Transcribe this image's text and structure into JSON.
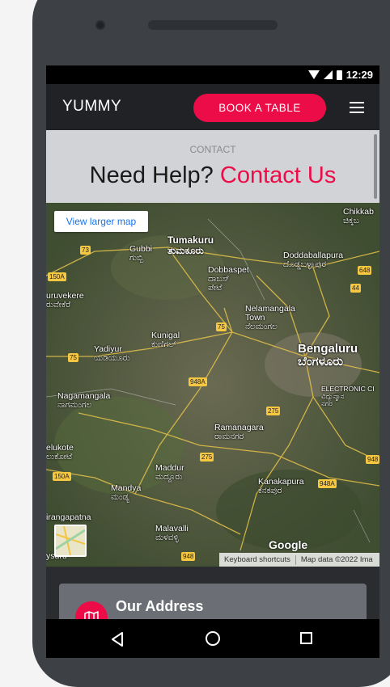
{
  "status": {
    "time": "12:29"
  },
  "header": {
    "logo": "YUMMY",
    "book_label": "BOOK A TABLE"
  },
  "section": {
    "label": "CONTACT",
    "title_plain": "Need Help?",
    "title_accent": "Contact Us"
  },
  "map": {
    "view_larger": "View larger map",
    "places": [
      {
        "name": "Tumakuru\nತುಮಕೂರು",
        "kind": "mid"
      },
      {
        "name": "Gubbi\nಗುಬ್ಬಿ",
        "kind": "small"
      },
      {
        "name": "Doddaballapura\nದೊಡ್ಡಬಳ್ಳಾಪುರ",
        "kind": "small"
      },
      {
        "name": "Chikkab\nಚಿಕ್ಕಬ",
        "kind": "small"
      },
      {
        "name": "Dobbaspet\nದಾಬಸ್\nಪೇಟೆ",
        "kind": "small"
      },
      {
        "name": "uruvekere\nರುವೇಕೆರೆ",
        "kind": "small"
      },
      {
        "name": "Nelamangala\nTown\nನೆಲಮಂಗಲ",
        "kind": "small"
      },
      {
        "name": "Kunigal\nಕುಣಿಗಲ್",
        "kind": "small"
      },
      {
        "name": "Yadiyur\nಯಡಿಯೂರು",
        "kind": "small"
      },
      {
        "name": "Bengaluru\nಬೆಂಗಳೂರು",
        "kind": "big"
      },
      {
        "name": "ELECTRONIC CI\nವಿದ್ಯುನ್ಮಾನ\nನಗರ",
        "kind": "small"
      },
      {
        "name": "Nagamangala\nನಾಗಮಂಗಲ",
        "kind": "small"
      },
      {
        "name": "Ramanagara\nರಾಮನಗರ",
        "kind": "small"
      },
      {
        "name": "elukote\nಲುಕೋಟೆ",
        "kind": "small"
      },
      {
        "name": "Maddur\nಮದ್ದೂರು",
        "kind": "small"
      },
      {
        "name": "Mandya\nಮಂಡ್ಯ",
        "kind": "small"
      },
      {
        "name": "Kanakapura\nಕನಕಪುರ",
        "kind": "small"
      },
      {
        "name": "irangapatna",
        "kind": "small"
      },
      {
        "name": "Malavalli\nಮಳವಳ್ಳಿ",
        "kind": "small"
      },
      {
        "name": "ysuru",
        "kind": "small"
      }
    ],
    "roads": [
      "73",
      "150A",
      "648",
      "44",
      "75",
      "75",
      "948A",
      "275",
      "275",
      "150A",
      "948A",
      "948",
      "948"
    ],
    "google": "Google",
    "footer_shortcuts": "Keyboard shortcuts",
    "footer_data": "Map data ©2022 Ima"
  },
  "address": {
    "title": "Our Address"
  },
  "colors": {
    "accent": "#ec0d48",
    "header_bg": "#202226",
    "section_bg": "#d2d3d6"
  }
}
